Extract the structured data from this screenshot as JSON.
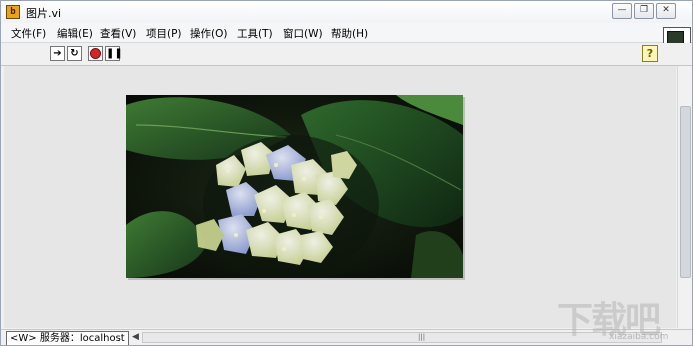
{
  "window": {
    "title": "图片.vi",
    "app_icon_text": "b"
  },
  "menu": [
    {
      "label": "文件(F)"
    },
    {
      "label": "编辑(E)"
    },
    {
      "label": "查看(V)"
    },
    {
      "label": "项目(P)"
    },
    {
      "label": "操作(O)"
    },
    {
      "label": "工具(T)"
    },
    {
      "label": "窗口(W)"
    },
    {
      "label": "帮助(H)"
    }
  ],
  "toolbar": {
    "icons": [
      "run-arrow-icon",
      "run-continuously-icon",
      "abort-icon",
      "pause-icon"
    ],
    "help_label": "?"
  },
  "panel": {
    "picture_description_icon": "hydrangea-image"
  },
  "status": {
    "server_label": "<W> 服务器：localhost"
  },
  "watermark": {
    "text": "下载吧",
    "sub": "xiazaiba.com"
  },
  "colors": {
    "panel_bg": "#e6e6e6",
    "window_bg": "#f0f0f0"
  }
}
